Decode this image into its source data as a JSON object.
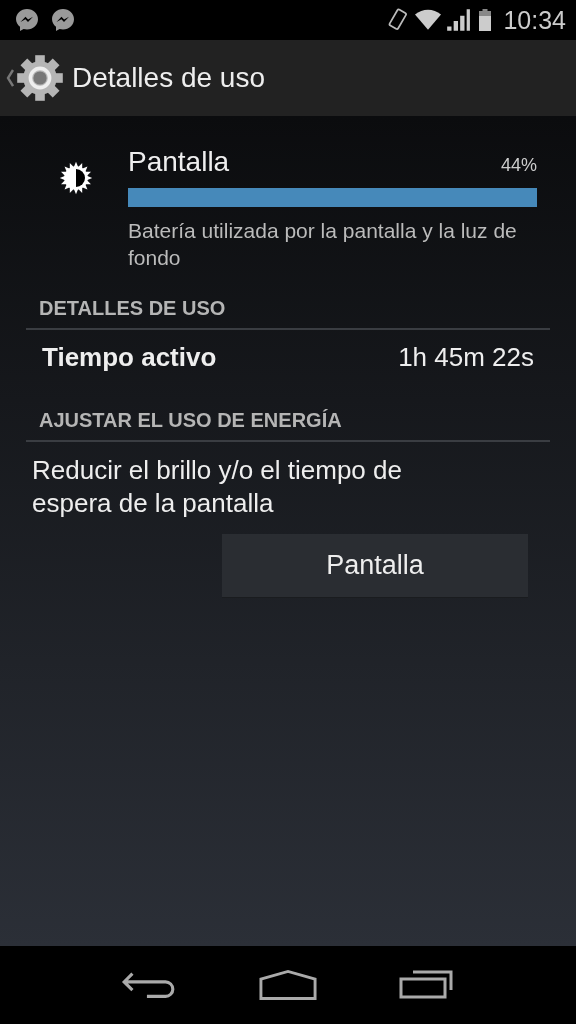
{
  "status_bar": {
    "time": "10:34"
  },
  "action_bar": {
    "title": "Detalles de uso"
  },
  "usage": {
    "title": "Pantalla",
    "percent": "44%",
    "level": 1,
    "description": "Batería utilizada por la pantalla y la luz de fondo"
  },
  "sections": [
    {
      "header": "DETALLES DE USO",
      "kind": "stats",
      "rows": [
        {
          "label": "Tiempo activo",
          "value": "1h 45m 22s"
        }
      ]
    },
    {
      "header": "AJUSTAR EL USO DE ENERGÍA",
      "kind": "action",
      "text": "Reducir el brillo y/o el tiempo de espera de la pantalla",
      "button": "Pantalla"
    }
  ]
}
